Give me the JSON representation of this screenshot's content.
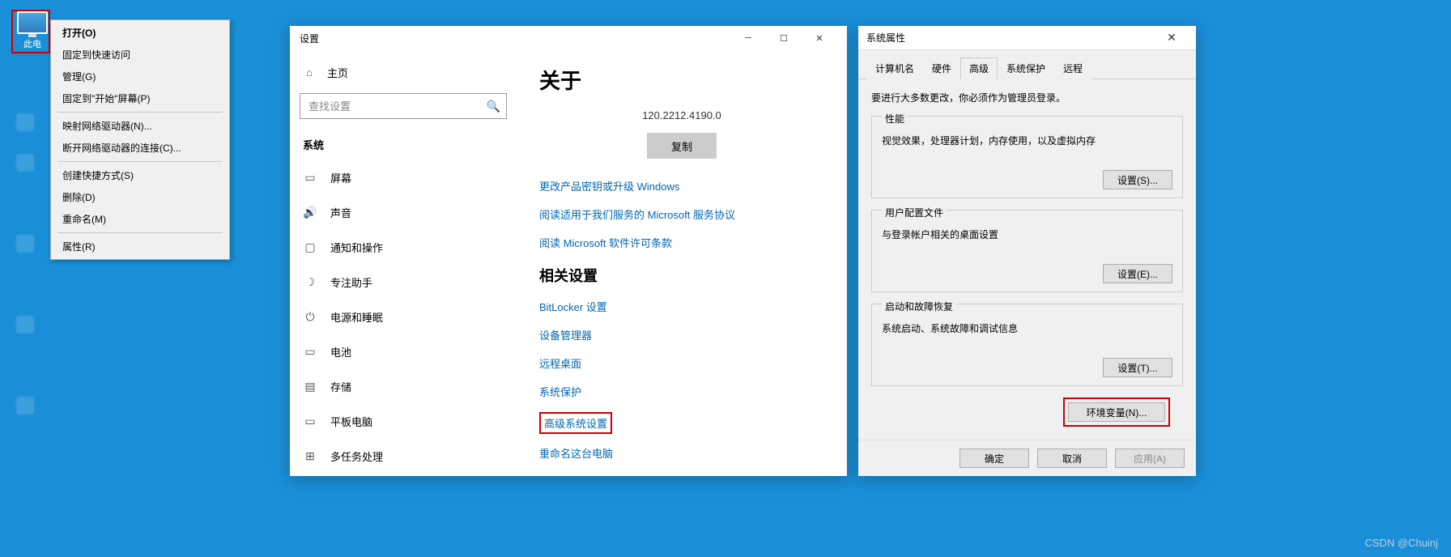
{
  "desktop": {
    "this_pc_label": "此电"
  },
  "context_menu": {
    "open": "打开(O)",
    "pin_quick": "固定到快速访问",
    "manage": "管理(G)",
    "pin_start": "固定到\"开始\"屏幕(P)",
    "map_drive": "映射网络驱动器(N)...",
    "disconnect_drive": "断开网络驱动器的连接(C)...",
    "create_shortcut": "创建快捷方式(S)",
    "delete": "删除(D)",
    "rename": "重命名(M)",
    "properties": "属性(R)"
  },
  "settings": {
    "title": "设置",
    "home": "主页",
    "search_placeholder": "查找设置",
    "group": "系统",
    "nav": {
      "display": "屏幕",
      "sound": "声音",
      "notifications": "通知和操作",
      "focus": "专注助手",
      "power": "电源和睡眠",
      "battery": "电池",
      "storage": "存储",
      "tablet": "平板电脑",
      "multitask": "多任务处理"
    },
    "about": {
      "heading": "关于",
      "version": "120.2212.4190.0",
      "copy": "复制",
      "link_productkey": "更改产品密钥或升级 Windows",
      "link_service": "阅读适用于我们服务的 Microsoft 服务协议",
      "link_license": "阅读 Microsoft 软件许可条款",
      "related_heading": "相关设置",
      "bitlocker": "BitLocker 设置",
      "devmgr": "设备管理器",
      "remote": "远程桌面",
      "sysprotect": "系统保护",
      "advanced": "高级系统设置",
      "rename_pc": "重命名这台电脑"
    }
  },
  "sysprops": {
    "title": "系统属性",
    "tabs": {
      "computer": "计算机名",
      "hardware": "硬件",
      "advanced": "高级",
      "protection": "系统保护",
      "remote": "远程"
    },
    "notice": "要进行大多数更改，你必须作为管理员登录。",
    "perf": {
      "legend": "性能",
      "desc": "视觉效果，处理器计划，内存使用，以及虚拟内存",
      "btn": "设置(S)..."
    },
    "profile": {
      "legend": "用户配置文件",
      "desc": "与登录帐户相关的桌面设置",
      "btn": "设置(E)..."
    },
    "startup": {
      "legend": "启动和故障恢复",
      "desc": "系统启动、系统故障和调试信息",
      "btn": "设置(T)..."
    },
    "env_btn": "环境变量(N)...",
    "ok": "确定",
    "cancel": "取消",
    "apply": "应用(A)"
  },
  "watermark": "CSDN @Chuinj"
}
